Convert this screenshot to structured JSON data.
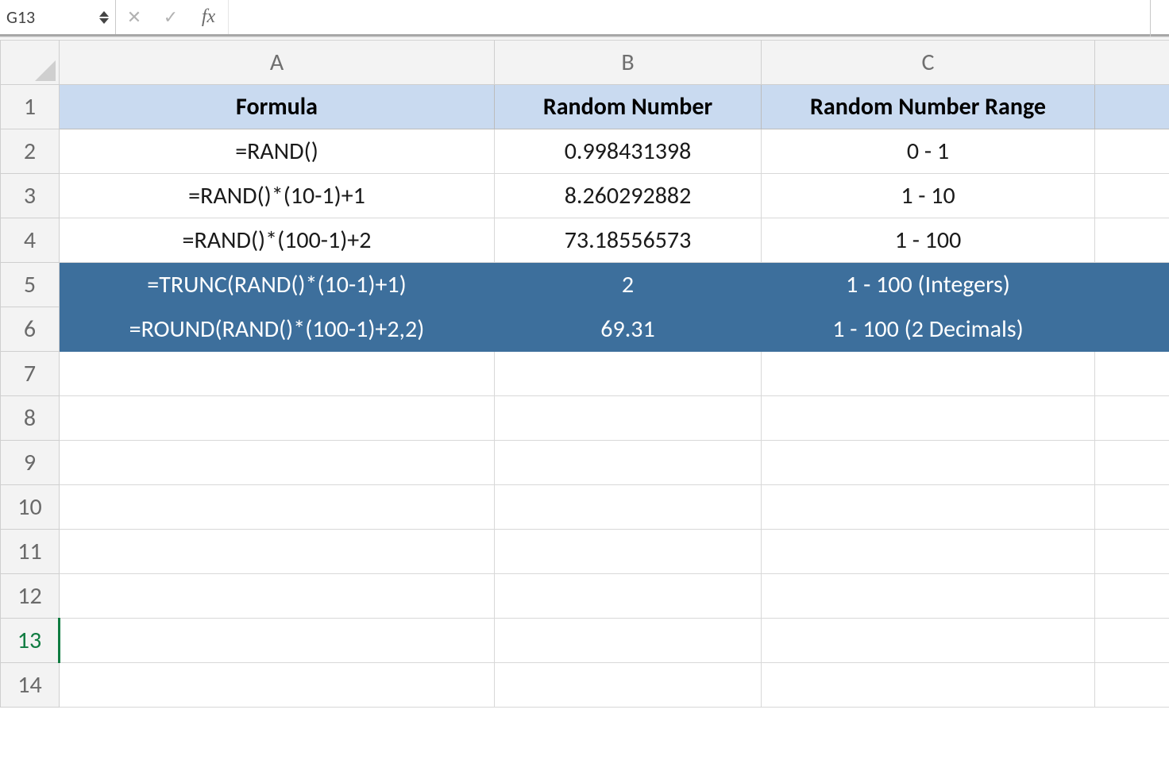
{
  "formula_bar": {
    "name_box": "G13",
    "cancel_glyph": "✕",
    "enter_glyph": "✓",
    "fx_label": "fx",
    "formula_value": ""
  },
  "columns": [
    "A",
    "B",
    "C"
  ],
  "row_numbers": [
    "1",
    "2",
    "3",
    "4",
    "5",
    "6",
    "7",
    "8",
    "9",
    "10",
    "11",
    "12",
    "13",
    "14"
  ],
  "active_row": "13",
  "header_row": {
    "A": "Formula",
    "B": "Random Number",
    "C": "Random Number Range"
  },
  "rows": [
    {
      "A": "=RAND()",
      "B": "0.998431398",
      "C": "0 - 1",
      "hl": false
    },
    {
      "A": "=RAND()*(10-1)+1",
      "B": "8.260292882",
      "C": "1 - 10",
      "hl": false
    },
    {
      "A": "=RAND()*(100-1)+2",
      "B": "73.18556573",
      "C": "1 - 100",
      "hl": false
    },
    {
      "A": "=TRUNC(RAND()*(10-1)+1)",
      "B": "2",
      "C": "1 - 100 (Integers)",
      "hl": true
    },
    {
      "A": "=ROUND(RAND()*(100-1)+2,2)",
      "B": "69.31",
      "C": "1 - 100 (2 Decimals)",
      "hl": true
    }
  ]
}
